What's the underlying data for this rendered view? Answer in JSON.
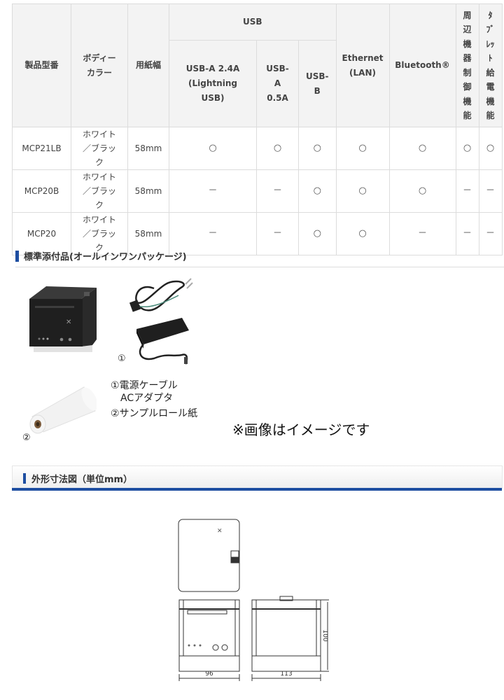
{
  "spec_table": {
    "headers": {
      "model": "製品型番",
      "body_color": "ボディーカラー",
      "paper_width": "用紙幅",
      "usb_group": "USB",
      "usb_a_24": "USB-A 2.4A (Lightning USB)",
      "usb_a_05": "USB-A 0.5A",
      "usb_b": "USB-B",
      "ethernet": "Ethernet (LAN)",
      "bluetooth": "Bluetooth®",
      "peripheral": [
        "周",
        "辺",
        "機",
        "器",
        "制",
        "御",
        "機",
        "能"
      ],
      "tablet_power": [
        "ﾀ",
        "ﾌﾞ",
        "ﾚｯ",
        "ﾄ",
        "給",
        "電",
        "機",
        "能"
      ]
    },
    "rows": [
      {
        "model": "MCP21LB",
        "color": "ホワイト／ブラック",
        "paper": "58mm",
        "usb_a_24": "○",
        "usb_a_05": "○",
        "usb_b": "○",
        "ethernet": "○",
        "bluetooth": "○",
        "peripheral": "○",
        "tablet_power": "○"
      },
      {
        "model": "MCP20B",
        "color": "ホワイト／ブラック",
        "paper": "58mm",
        "usb_a_24": "－",
        "usb_a_05": "－",
        "usb_b": "○",
        "ethernet": "○",
        "bluetooth": "○",
        "peripheral": "－",
        "tablet_power": "－"
      },
      {
        "model": "MCP20",
        "color": "ホワイト／ブラック",
        "paper": "58mm",
        "usb_a_24": "－",
        "usb_a_05": "－",
        "usb_b": "○",
        "ethernet": "○",
        "bluetooth": "－",
        "peripheral": "－",
        "tablet_power": "－"
      }
    ]
  },
  "accessories": {
    "heading": "標準添付品(オールインワンパッケージ)",
    "label_1_num": "①",
    "label_2_num": "②",
    "legend": [
      "①電源ケーブル",
      "　ACアダプタ",
      "②サンプルロール紙"
    ],
    "note": "※画像はイメージです"
  },
  "dimensions": {
    "heading": "外形寸法図（単位mm）",
    "width": "96",
    "depth": "113",
    "height": "100"
  },
  "colors": {
    "accent": "#1e4ea1",
    "header_bg": "#f3f3f3",
    "border": "#dcdcdc"
  }
}
